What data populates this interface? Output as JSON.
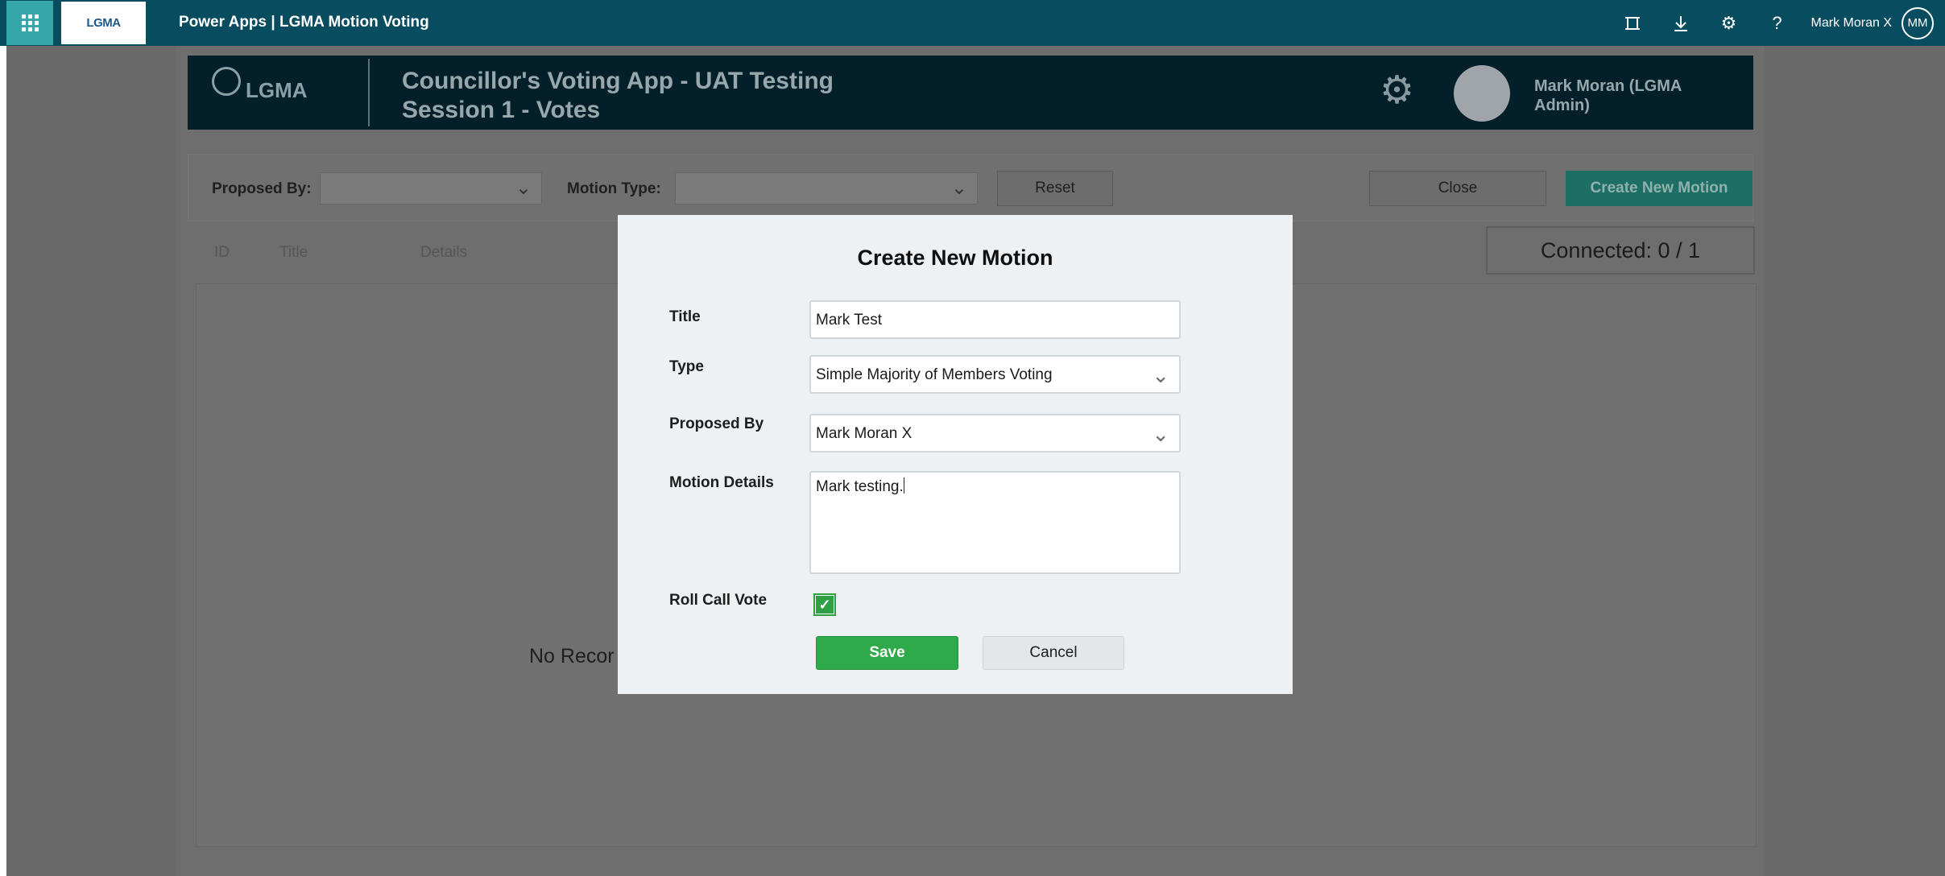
{
  "topbar": {
    "title": "Power Apps  |  LGMA Motion Voting",
    "org_logo": "LGMA",
    "user_name": "Mark Moran X",
    "user_initials": "MM",
    "icons": [
      "fit-to-screen-icon",
      "download-icon",
      "settings-gear-icon",
      "help-icon"
    ]
  },
  "app_header": {
    "logo_text": "LGMA",
    "title_line1": "Councillor's Voting App - UAT Testing",
    "title_line2": "Session 1 - Votes",
    "user_line1": "Mark Moran (LGMA",
    "user_line2": "Admin)"
  },
  "filters": {
    "proposed_by_label": "Proposed By:",
    "motion_type_label": "Motion Type:",
    "reset_label": "Reset",
    "close_label": "Close",
    "create_label": "Create New Motion"
  },
  "connected": "Connected: 0 / 1",
  "table": {
    "headers": [
      "ID",
      "Title",
      "Details"
    ],
    "empty_text_visible": "No Recor"
  },
  "modal": {
    "title": "Create New Motion",
    "title_label": "Title",
    "title_value": "Mark Test",
    "type_label": "Type",
    "type_value": "Simple Majority of Members Voting",
    "proposed_by_label": "Proposed By",
    "proposed_by_value": "Mark Moran X",
    "details_label": "Motion Details",
    "details_value": "Mark testing.",
    "roll_call_label": "Roll Call Vote",
    "roll_call_checked": true,
    "save_label": "Save",
    "cancel_label": "Cancel"
  },
  "colors": {
    "topbar": "#084d5f",
    "waffle": "#37a6a8",
    "save_green": "#2eaa4a",
    "create_teal": "#1d6e64"
  }
}
